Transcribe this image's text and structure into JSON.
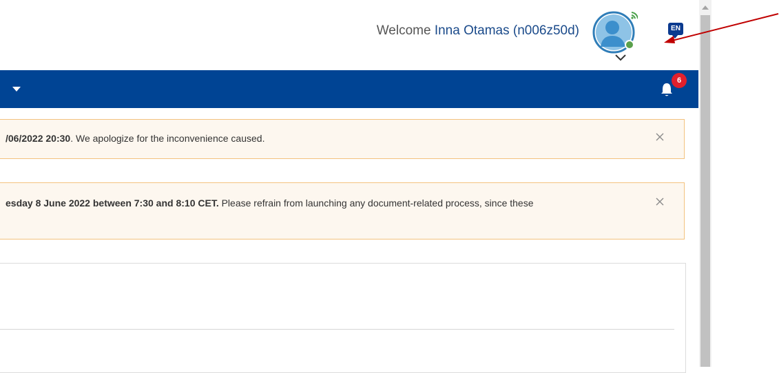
{
  "header": {
    "welcome_prefix": "Welcome",
    "user_name": "Inna Otamas (n006z50d)",
    "language": "EN",
    "avatar_status_color": "#4a9a4a"
  },
  "navbar": {
    "background": "#004494",
    "notification_count": "6"
  },
  "alerts": [
    {
      "bold_text": "/06/2022 20:30",
      "text": ". We apologize for the inconvenience caused."
    },
    {
      "bold_text": "esday 8 June 2022 between 7:30 and 8:10 CET.",
      "text": " Please refrain from launching any document-related process, since these"
    }
  ],
  "icons": {
    "alert_close": "close-icon",
    "notification": "bell-icon",
    "avatar": "user-avatar-icon",
    "nav_caret": "caret-down-icon",
    "annotation": "red-arrow-icon"
  }
}
